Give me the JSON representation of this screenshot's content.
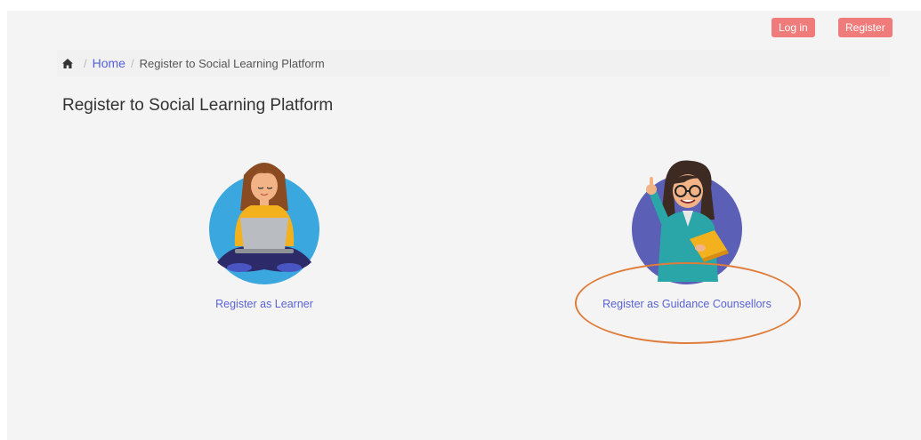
{
  "header": {
    "login_label": "Log in",
    "register_label": "Register"
  },
  "breadcrumb": {
    "home_icon": "home-icon",
    "home_label": "Home",
    "current": "Register to Social Learning Platform"
  },
  "page": {
    "title": "Register to Social Learning Platform"
  },
  "options": [
    {
      "label": "Register as Learner",
      "icon": "learner-illustration"
    },
    {
      "label": "Register as Guidance Counsellors",
      "icon": "counsellor-illustration"
    }
  ],
  "colors": {
    "accent_button": "#ef7c7a",
    "link": "#5561d8",
    "annotation": "#e07c3a",
    "learner_circle": "#3aa7df",
    "counsellor_circle": "#5b5fb6"
  }
}
